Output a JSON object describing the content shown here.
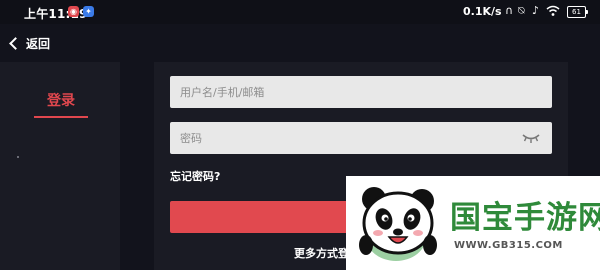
{
  "status_bar": {
    "time": "上午11:19",
    "speed": "0.1K/s",
    "battery": "61"
  },
  "nav": {
    "back_label": "返回"
  },
  "sidebar": {
    "tab_login": "登录"
  },
  "form": {
    "username_placeholder": "用户名/手机/邮箱",
    "password_placeholder": "密码",
    "forgot_password": "忘记密码?",
    "more_login_methods": "更多方式登"
  },
  "colors": {
    "accent": "#e1494f",
    "background": "#12131c",
    "panel": "#1a1b24",
    "watermark_green": "#2f8a3a"
  },
  "watermark": {
    "title": "国宝手游网",
    "url": "WWW.GB315.COM"
  }
}
